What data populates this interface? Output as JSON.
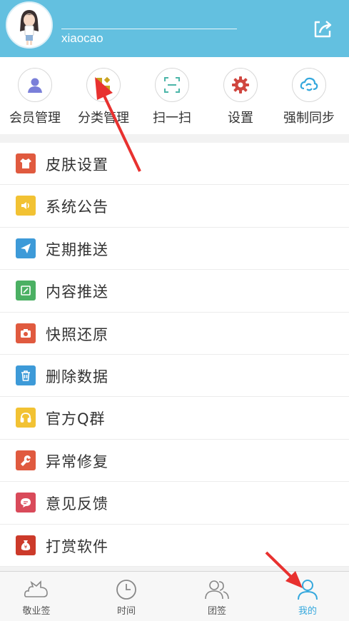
{
  "header": {
    "username": "xiaocao",
    "bg_color": "#63c0e0"
  },
  "quick_actions": [
    {
      "label": "会员管理",
      "icon": "member-icon"
    },
    {
      "label": "分类管理",
      "icon": "category-icon"
    },
    {
      "label": "扫一扫",
      "icon": "scan-icon"
    },
    {
      "label": "设置",
      "icon": "gear-icon"
    },
    {
      "label": "强制同步",
      "icon": "sync-icon"
    }
  ],
  "menu": [
    {
      "label": "皮肤设置",
      "icon": "shirt-icon",
      "color": "#e05a3f"
    },
    {
      "label": "系统公告",
      "icon": "speaker-icon",
      "color": "#f2c233"
    },
    {
      "label": "定期推送",
      "icon": "paper-plane-icon",
      "color": "#3d9ad8"
    },
    {
      "label": "内容推送",
      "icon": "edit-icon",
      "color": "#4bb063"
    },
    {
      "label": "快照还原",
      "icon": "camera-icon",
      "color": "#e05a3f"
    },
    {
      "label": "删除数据",
      "icon": "trash-icon",
      "color": "#3d9ad8"
    },
    {
      "label": "官方Q群",
      "icon": "headset-icon",
      "color": "#f2c233"
    },
    {
      "label": "异常修复",
      "icon": "wrench-icon",
      "color": "#e05a3f"
    },
    {
      "label": "意见反馈",
      "icon": "chat-icon",
      "color": "#d94a5a"
    },
    {
      "label": "打赏软件",
      "icon": "money-bag-icon",
      "color": "#cc3a2a"
    }
  ],
  "tabs": [
    {
      "label": "敬业签",
      "icon": "cloud-icon",
      "active": false
    },
    {
      "label": "时间",
      "icon": "clock-icon",
      "active": false
    },
    {
      "label": "团签",
      "icon": "group-icon",
      "active": false
    },
    {
      "label": "我的",
      "icon": "person-icon",
      "active": true
    }
  ],
  "accent_color": "#35a8dd"
}
